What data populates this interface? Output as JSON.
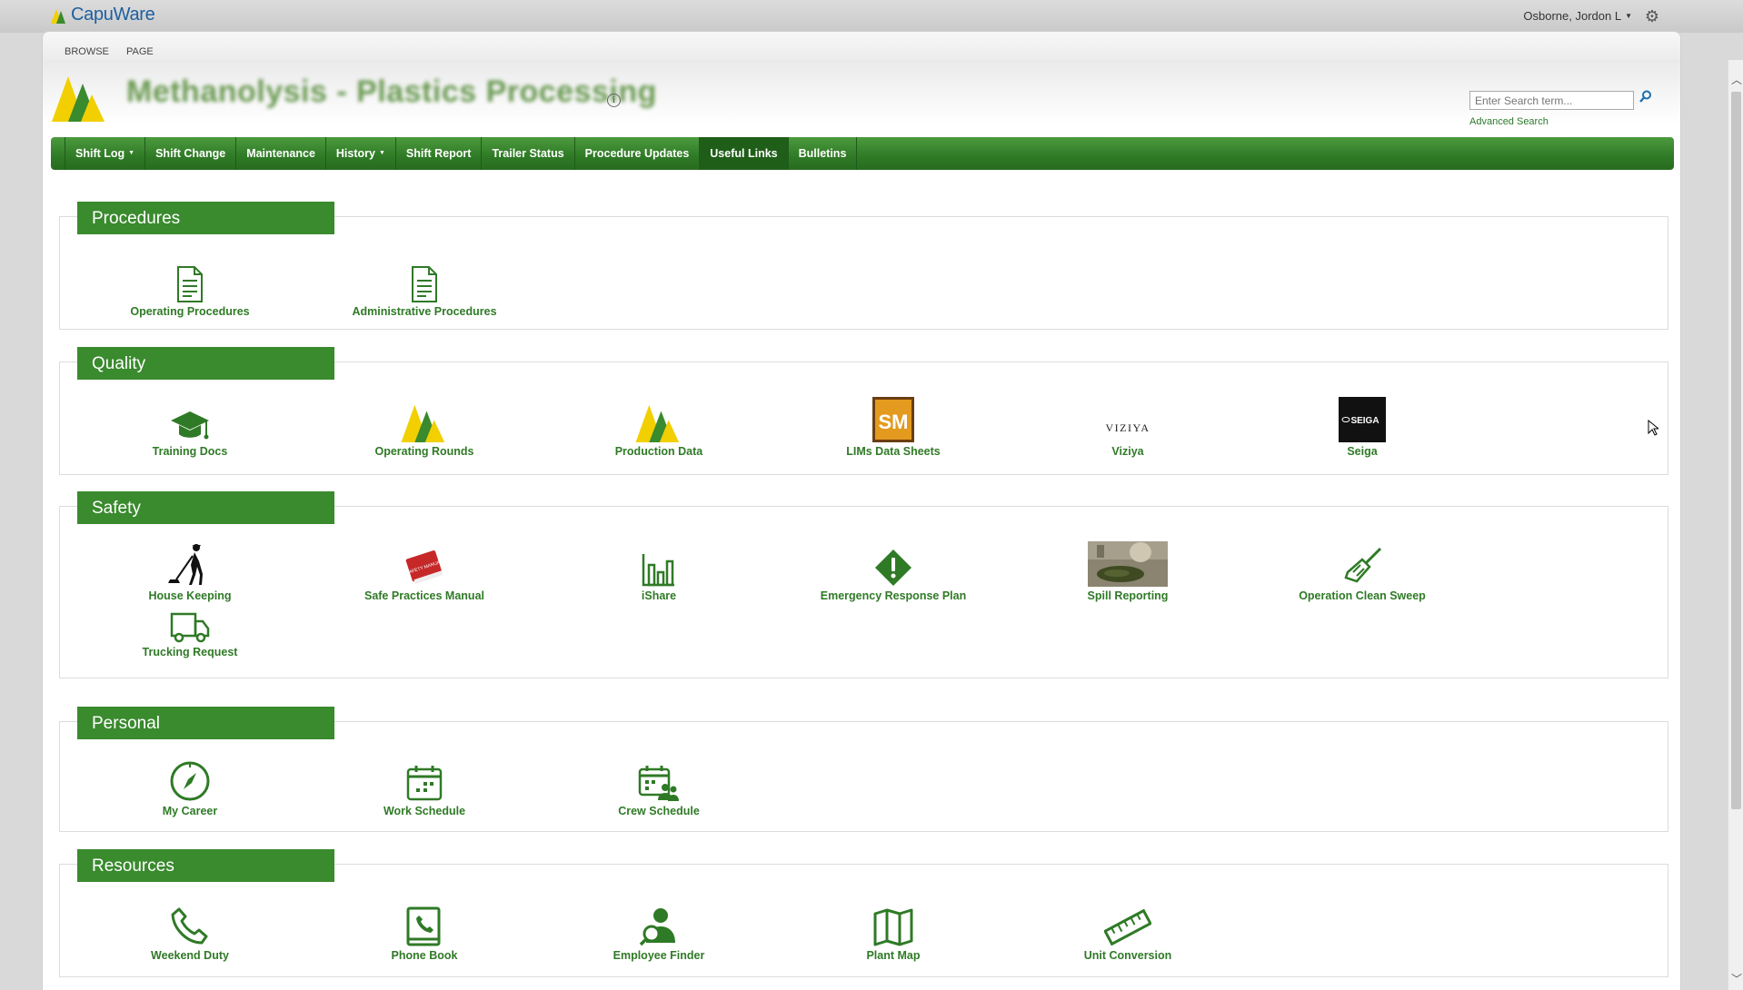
{
  "app": {
    "brand": "CapuWare",
    "user": "Osborne, Jordon L"
  },
  "ribbon": {
    "tabs": [
      "BROWSE",
      "PAGE"
    ]
  },
  "site": {
    "title": "Methanolysis - Plastics Processing"
  },
  "search": {
    "placeholder": "Enter Search term...",
    "advanced": "Advanced Search"
  },
  "nav": {
    "items": [
      {
        "label": "Shift Log",
        "dropdown": true
      },
      {
        "label": "Shift Change"
      },
      {
        "label": "Maintenance"
      },
      {
        "label": "History",
        "dropdown": true
      },
      {
        "label": "Shift Report"
      },
      {
        "label": "Trailer Status"
      },
      {
        "label": "Procedure Updates"
      },
      {
        "label": "Useful Links",
        "active": true
      },
      {
        "label": "Bulletins"
      }
    ]
  },
  "sections": {
    "procedures": {
      "title": "Procedures",
      "tiles": [
        {
          "label": "Operating Procedures",
          "icon": "document-icon"
        },
        {
          "label": "Administrative Procedures",
          "icon": "document-icon"
        }
      ]
    },
    "quality": {
      "title": "Quality",
      "tiles": [
        {
          "label": "Training Docs",
          "icon": "graduation-cap-icon"
        },
        {
          "label": "Operating Rounds",
          "icon": "company-logo-icon"
        },
        {
          "label": "Production Data",
          "icon": "company-logo-icon"
        },
        {
          "label": "LIMs Data Sheets",
          "icon": "sm-logo-icon",
          "logo_text": "SM"
        },
        {
          "label": "Viziya",
          "icon": "viziya-logo-icon",
          "logo_text": "VIZIYA"
        },
        {
          "label": "Seiga",
          "icon": "seiga-logo-icon",
          "logo_text": "SEIGA"
        }
      ]
    },
    "safety": {
      "title": "Safety",
      "tiles": [
        {
          "label": "House Keeping",
          "icon": "sweeper-person-icon"
        },
        {
          "label": "Safe Practices Manual",
          "icon": "manual-book-icon",
          "logo_text": "SAFETY MANUAL"
        },
        {
          "label": "iShare",
          "icon": "bar-chart-icon"
        },
        {
          "label": "Emergency Response Plan",
          "icon": "warning-diamond-icon"
        },
        {
          "label": "Spill Reporting",
          "icon": "spill-photo-icon"
        },
        {
          "label": "Operation Clean Sweep",
          "icon": "broom-icon"
        },
        {
          "label": "Trucking Request",
          "icon": "truck-icon"
        }
      ]
    },
    "personal": {
      "title": "Personal",
      "tiles": [
        {
          "label": "My Career",
          "icon": "compass-icon"
        },
        {
          "label": "Work Schedule",
          "icon": "calendar-icon"
        },
        {
          "label": "Crew Schedule",
          "icon": "crew-calendar-icon"
        }
      ]
    },
    "resources": {
      "title": "Resources",
      "tiles": [
        {
          "label": "Weekend Duty",
          "icon": "phone-icon"
        },
        {
          "label": "Phone Book",
          "icon": "phone-book-icon"
        },
        {
          "label": "Employee Finder",
          "icon": "person-search-icon"
        },
        {
          "label": "Plant Map",
          "icon": "map-icon"
        },
        {
          "label": "Unit Conversion",
          "icon": "ruler-icon"
        }
      ]
    }
  },
  "colors": {
    "green": "#3a8a2e",
    "link_green": "#2f7a26",
    "brand_blue": "#1d5fa0",
    "logo_yellow": "#f2cf00"
  }
}
